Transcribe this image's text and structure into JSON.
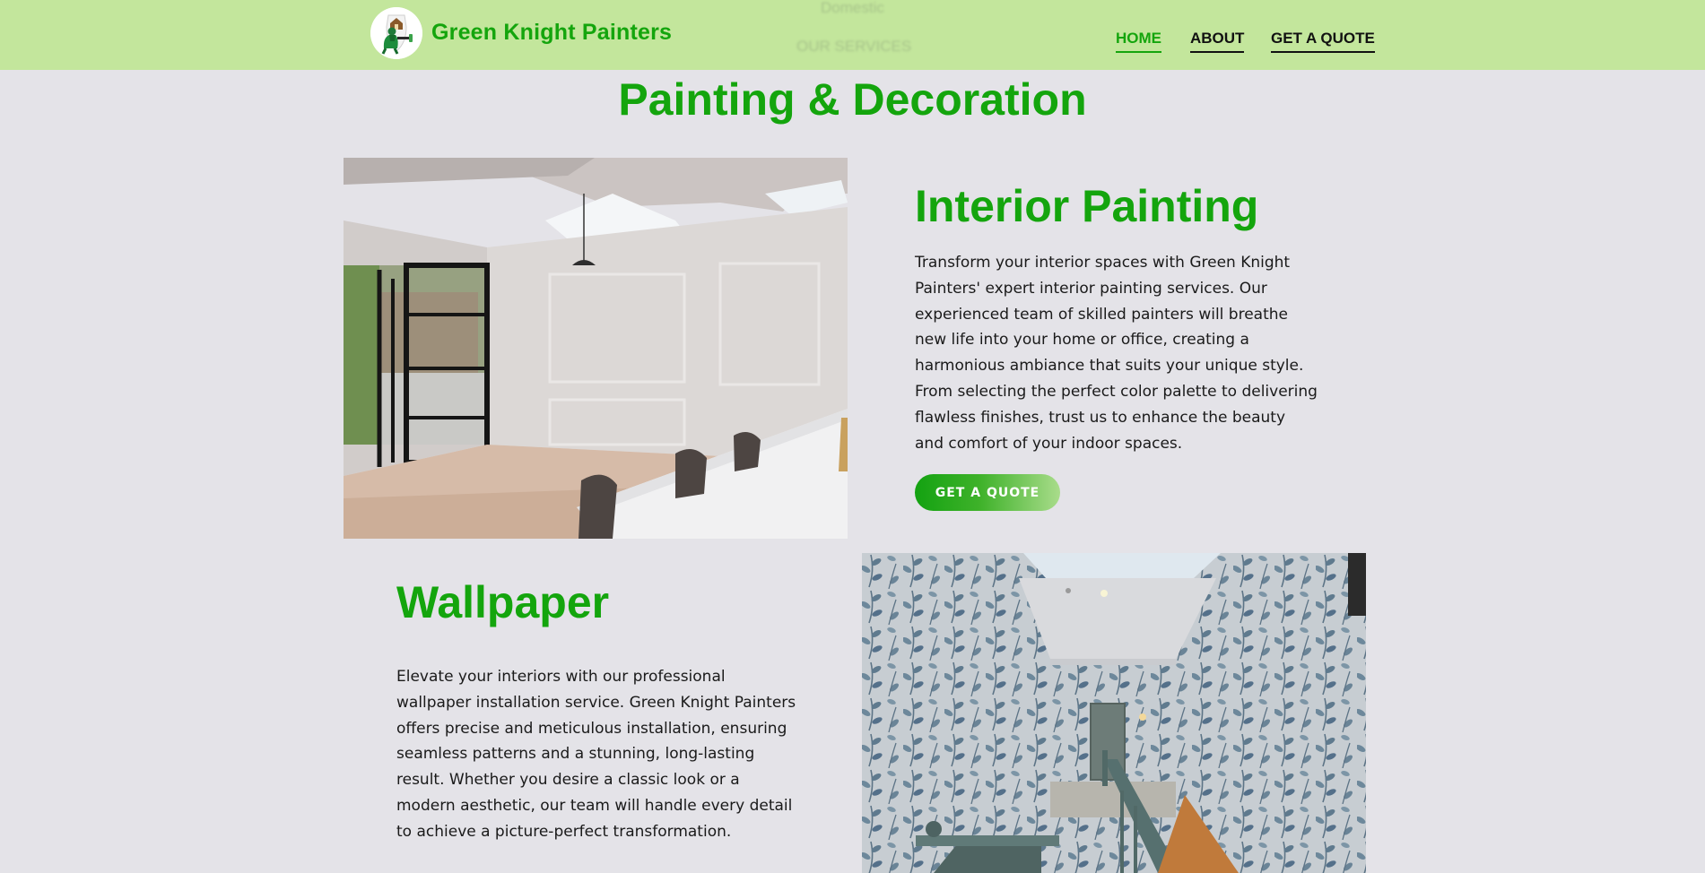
{
  "header": {
    "brand_name": "Green Knight Painters",
    "ghost_text_1": "Domestic",
    "ghost_text_2": "OUR SERVICES",
    "nav": [
      {
        "label": "HOME",
        "active": true
      },
      {
        "label": "ABOUT",
        "active": false
      },
      {
        "label": "GET A QUOTE",
        "active": false
      }
    ]
  },
  "page": {
    "section_title": "Painting & Decoration"
  },
  "services": {
    "interior": {
      "title": "Interior Painting",
      "body": "Transform your interior spaces with Green Knight Painters' expert interior painting services. Our experienced team of skilled painters will breathe new life into your home or office, creating a harmonious ambiance that suits your unique style. From selecting the perfect color palette to delivering flawless finishes, trust us to enhance the beauty and comfort of your indoor spaces.",
      "button_label": "GET A QUOTE"
    },
    "wallpaper": {
      "title": "Wallpaper",
      "body": "Elevate your interiors with our professional wallpaper installation service. Green Knight Painters offers precise and meticulous installation, ensuring seamless patterns and a stunning, long-lasting result. Whether you desire a classic look or a modern aesthetic, our team will handle every detail to achieve a picture-perfect transformation."
    }
  },
  "colors": {
    "header_bg": "#c3e69c",
    "brand_green": "#14a50d",
    "page_bg": "#e4e3e8"
  },
  "icons": {
    "logo": "knight-painter-logo-icon"
  }
}
